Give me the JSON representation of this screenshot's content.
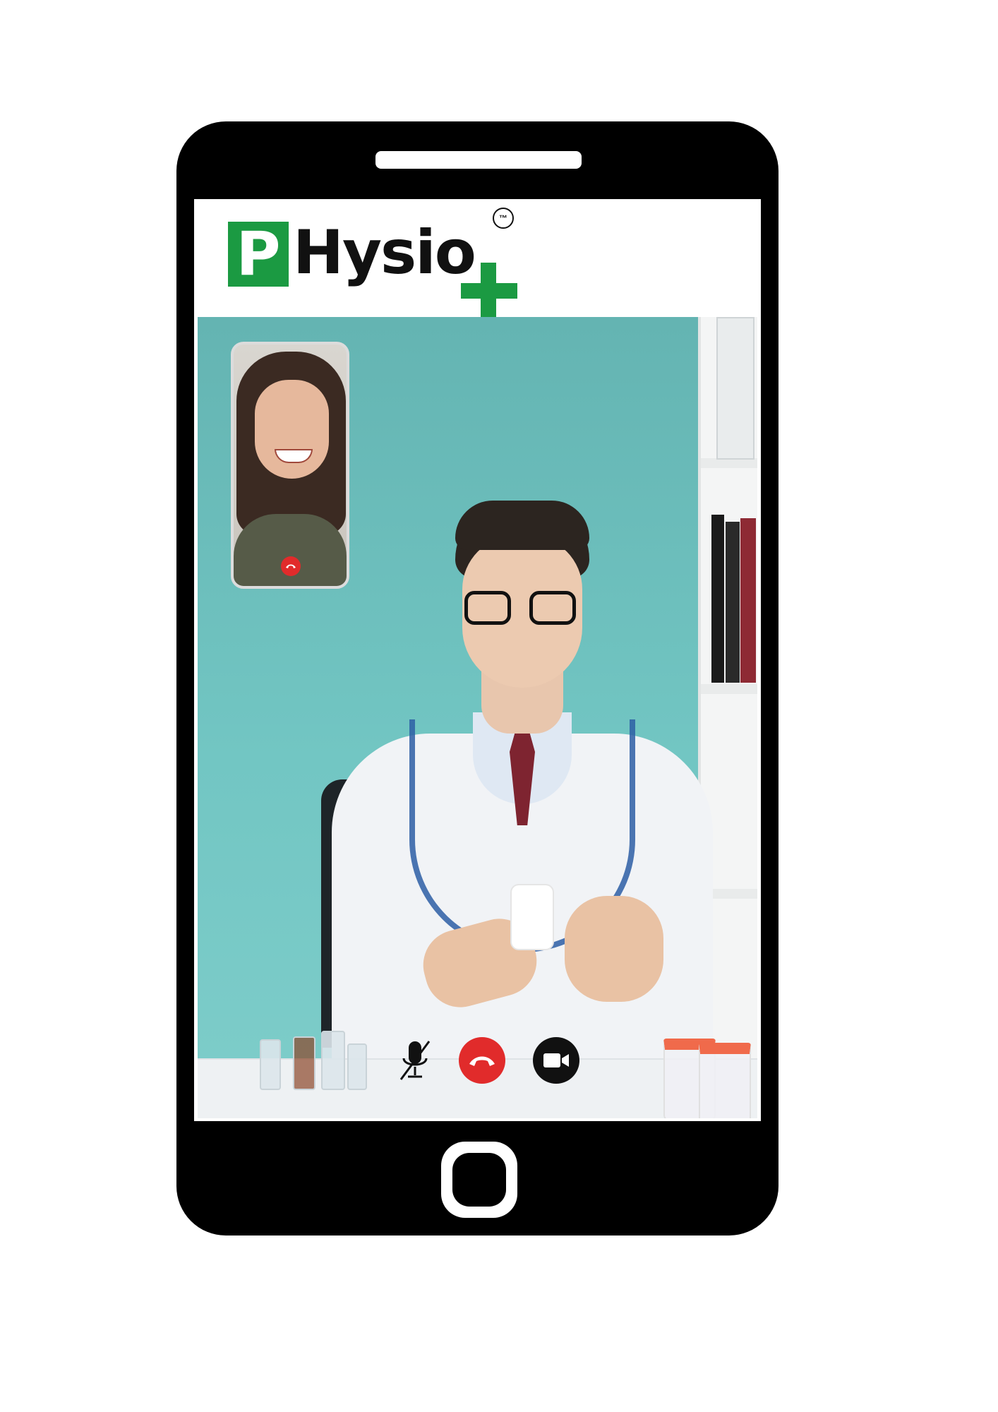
{
  "app": {
    "logo_letter": "P",
    "logo_word": "Hysio",
    "logo_mark": "™",
    "brand_color": "#1b9a42"
  },
  "call": {
    "self_view_end_icon": "end-call-icon",
    "controls": [
      {
        "name": "mute-button",
        "icon": "mic-off-icon"
      },
      {
        "name": "end-call-button",
        "icon": "end-call-icon",
        "color": "#e12b2b"
      },
      {
        "name": "camera-button",
        "icon": "video-camera-icon"
      }
    ]
  }
}
